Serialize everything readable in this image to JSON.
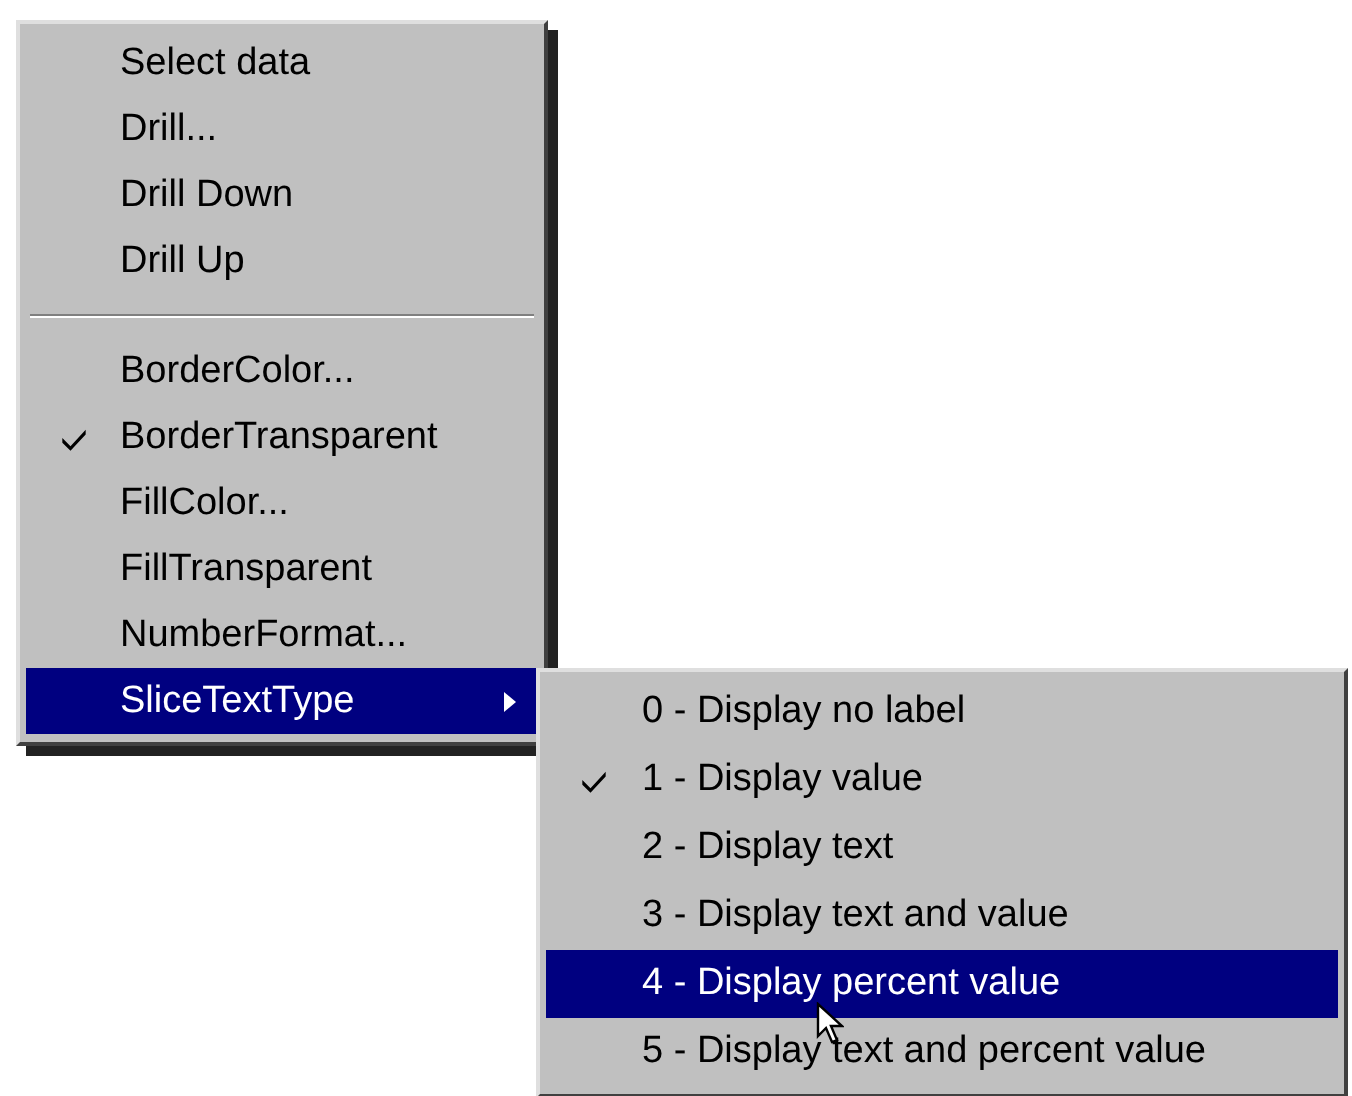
{
  "menu": {
    "items": [
      {
        "kind": "item",
        "label": "Select data",
        "checked": false,
        "selected": false,
        "submenu": false
      },
      {
        "kind": "item",
        "label": "Drill...",
        "checked": false,
        "selected": false,
        "submenu": false
      },
      {
        "kind": "item",
        "label": "Drill Down",
        "checked": false,
        "selected": false,
        "submenu": false
      },
      {
        "kind": "item",
        "label": "Drill Up",
        "checked": false,
        "selected": false,
        "submenu": false
      },
      {
        "kind": "separator"
      },
      {
        "kind": "item",
        "label": "BorderColor...",
        "checked": false,
        "selected": false,
        "submenu": false
      },
      {
        "kind": "item",
        "label": "BorderTransparent",
        "checked": true,
        "selected": false,
        "submenu": false
      },
      {
        "kind": "item",
        "label": "FillColor...",
        "checked": false,
        "selected": false,
        "submenu": false
      },
      {
        "kind": "item",
        "label": "FillTransparent",
        "checked": false,
        "selected": false,
        "submenu": false
      },
      {
        "kind": "item",
        "label": "NumberFormat...",
        "checked": false,
        "selected": false,
        "submenu": false
      },
      {
        "kind": "item",
        "label": "SliceTextType",
        "checked": false,
        "selected": true,
        "submenu": true
      }
    ]
  },
  "submenu": {
    "items": [
      {
        "label": "0 - Display no label",
        "checked": false,
        "selected": false
      },
      {
        "label": "1 - Display value",
        "checked": true,
        "selected": false
      },
      {
        "label": "2 - Display text",
        "checked": false,
        "selected": false
      },
      {
        "label": "3 - Display text and value",
        "checked": false,
        "selected": false
      },
      {
        "label": "4 - Display percent value",
        "checked": false,
        "selected": true
      },
      {
        "label": "5 - Display text and percent value",
        "checked": false,
        "selected": false
      }
    ]
  }
}
